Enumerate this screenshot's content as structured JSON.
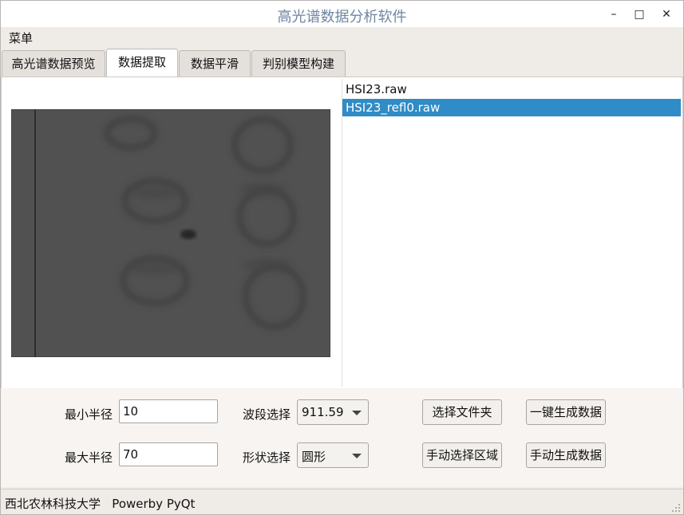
{
  "window": {
    "title": "高光谱数据分析软件"
  },
  "titlebar_buttons": {
    "minimize": "–",
    "maximize": "□",
    "close": "✕"
  },
  "menubar": {
    "menu_label": "菜单"
  },
  "tabs": [
    {
      "label": "高光谱数据预览"
    },
    {
      "label": "数据提取",
      "active": true
    },
    {
      "label": "数据平滑"
    },
    {
      "label": "判别模型构建"
    }
  ],
  "files": [
    {
      "name": "HSI23.raw"
    },
    {
      "name": "HSI23_refl0.raw",
      "selected": true
    }
  ],
  "controls": {
    "min_radius_label": "最小半径",
    "min_radius_value": "10",
    "max_radius_label": "最大半径",
    "max_radius_value": "70",
    "band_label": "波段选择",
    "band_value": "911.59",
    "shape_label": "形状选择",
    "shape_value": "圆形",
    "select_folder_button": "选择文件夹",
    "generate_data_button": "一键生成数据",
    "manual_region_button": "手动选择区域",
    "manual_generate_button": "手动生成数据"
  },
  "statusbar": {
    "text": "西北农林科技大学   Powerby PyQt"
  },
  "colors": {
    "selection": "#308cc6",
    "title_text": "#6f86a0",
    "image_bg": "#4d4d4d"
  },
  "icons": {
    "combo_arrow": "chevron-down-icon",
    "grip": "resize-grip-icon"
  }
}
